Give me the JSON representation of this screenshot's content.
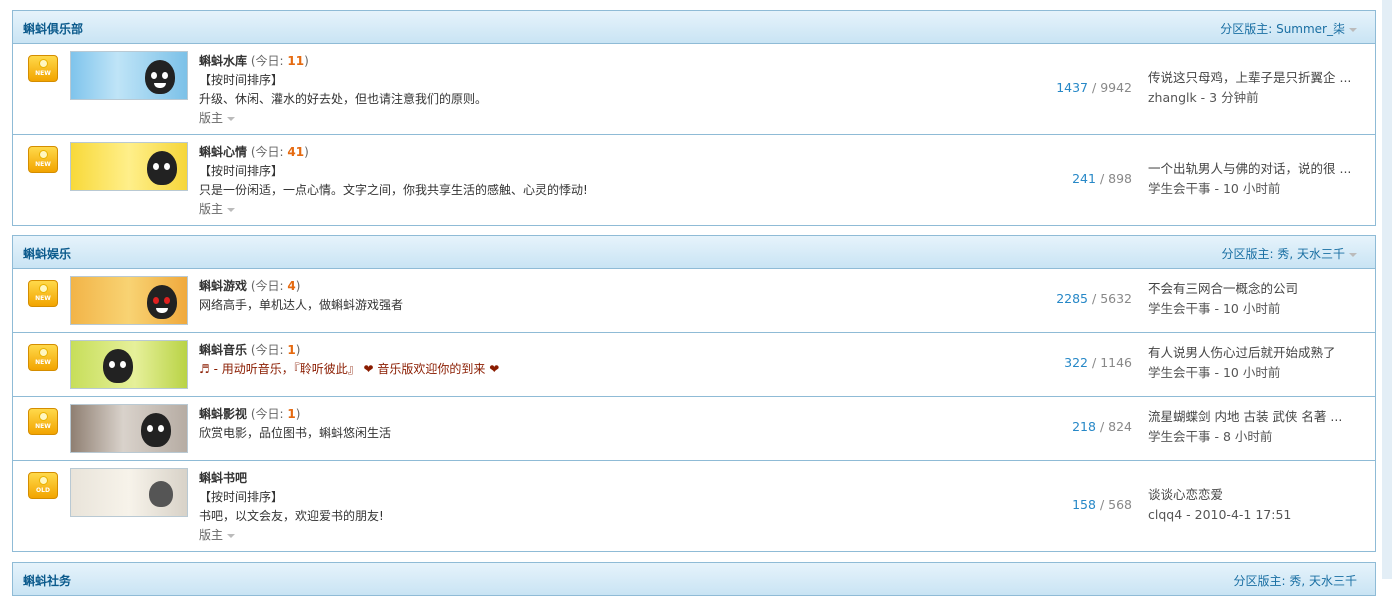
{
  "sections": [
    {
      "title": "蝌蚪俱乐部",
      "moderator_label": "分区版主: Summer_柒",
      "forums": [
        {
          "badge": "NEW",
          "name": "蝌蚪水库",
          "today_prefix": "(今日: ",
          "today": "11",
          "today_suffix": ")",
          "sort": "【按时间排序】",
          "desc": "升级、休闲、灌水的好去处，但也请注意我们的原则。",
          "mods": "版主",
          "topics": "1437",
          "sep": " / ",
          "posts": "9942",
          "last_title": "传说这只母鸡，上辈子是只折翼企 ...",
          "last_by": "zhanglk - 3 分钟前"
        },
        {
          "badge": "NEW",
          "name": "蝌蚪心情",
          "today_prefix": "(今日: ",
          "today": "41",
          "today_suffix": ")",
          "sort": "【按时间排序】",
          "desc": "只是一份闲适，一点心情。文字之间，你我共享生活的感触、心灵的悸动!",
          "mods": "版主",
          "topics": "241",
          "sep": " / ",
          "posts": "898",
          "last_title": "一个出轨男人与佛的对话，说的很 ...",
          "last_by": "学生会干事 - 10 小时前"
        }
      ]
    },
    {
      "title": "蝌蚪娱乐",
      "moderator_label": "分区版主: 秀, 天水三千",
      "forums": [
        {
          "badge": "NEW",
          "name": "蝌蚪游戏",
          "today_prefix": "(今日: ",
          "today": "4",
          "today_suffix": ")",
          "desc": "网络高手，单机达人，做蝌蚪游戏强者",
          "topics": "2285",
          "sep": " / ",
          "posts": "5632",
          "last_title": "不会有三网合一概念的公司",
          "last_by": "学生会干事 - 10 小时前"
        },
        {
          "badge": "NEW",
          "name": "蝌蚪音乐",
          "today_prefix": "(今日: ",
          "today": "1",
          "today_suffix": ")",
          "desc": "♬ - 用动听音乐，『聆听彼此』 ❤ 音乐版欢迎你的到来 ❤",
          "topics": "322",
          "sep": " / ",
          "posts": "1146",
          "last_title": "有人说男人伤心过后就开始成熟了",
          "last_by": "学生会干事 - 10 小时前"
        },
        {
          "badge": "NEW",
          "name": "蝌蚪影视",
          "today_prefix": "(今日: ",
          "today": "1",
          "today_suffix": ")",
          "desc": "欣赏电影，品位图书，蝌蚪悠闲生活",
          "topics": "218",
          "sep": " / ",
          "posts": "824",
          "last_title": "流星蝴蝶剑 内地 古装 武侠 名著 ...",
          "last_by": "学生会干事 - 8 小时前"
        },
        {
          "badge": "OLD",
          "name": "蝌蚪书吧",
          "sort": "【按时间排序】",
          "desc": "书吧，以文会友，欢迎爱书的朋友!",
          "mods": "版主",
          "topics": "158",
          "sep": " / ",
          "posts": "568",
          "last_title": "谈谈心恋恋爱",
          "last_by": "clqq4 - 2010-4-1 17:51"
        }
      ]
    },
    {
      "title": "蝌蚪社务",
      "moderator_label": "分区版主: 秀, 天水三千"
    }
  ]
}
